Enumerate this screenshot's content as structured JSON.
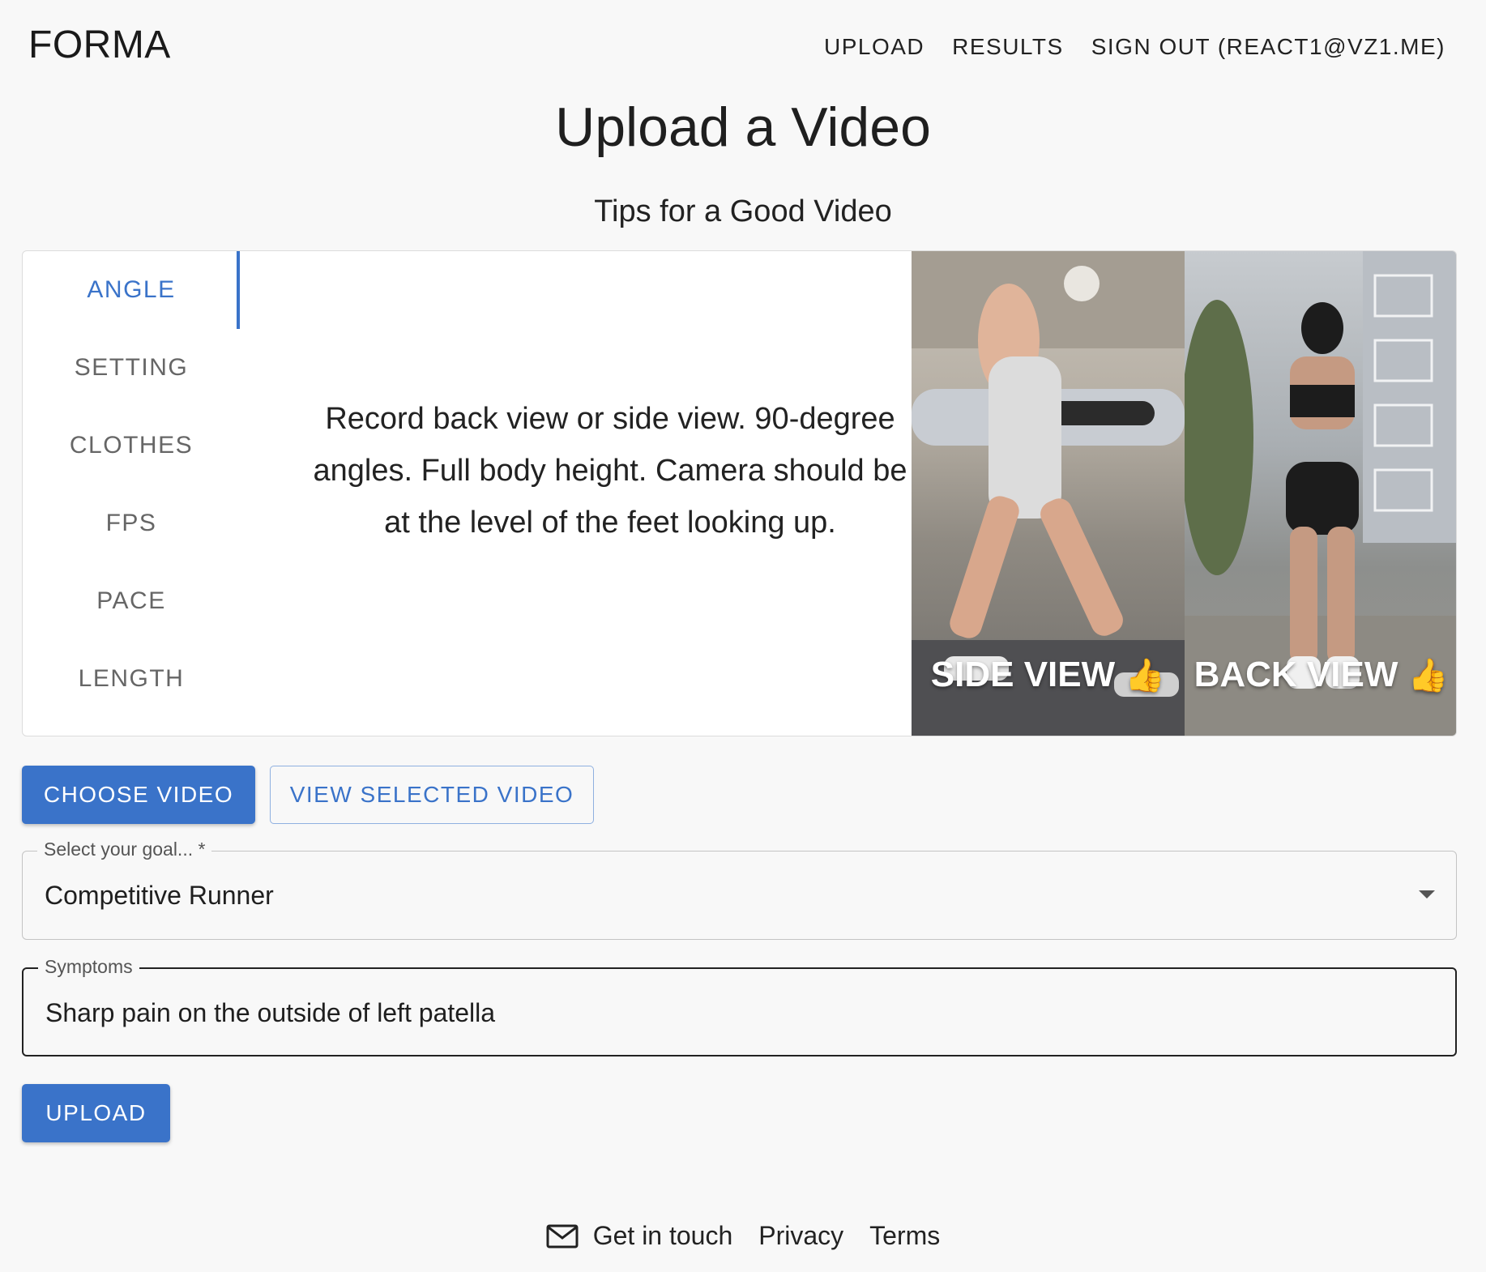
{
  "header": {
    "brand": "FORMA",
    "nav": {
      "upload": "UPLOAD",
      "results": "RESULTS",
      "sign_out": "SIGN OUT (REACT1@VZ1.ME)"
    }
  },
  "page": {
    "title": "Upload a Video",
    "subtitle": "Tips for a Good Video"
  },
  "tips": {
    "tabs": [
      "ANGLE",
      "SETTING",
      "CLOTHES",
      "FPS",
      "PACE",
      "LENGTH"
    ],
    "active_tab": "ANGLE",
    "text": "Record back view or side view. 90-degree angles. Full body height. Camera should be at the level of the feet looking up.",
    "photos": {
      "side_label": "SIDE VIEW",
      "back_label": "BACK VIEW",
      "emoji": "👍"
    }
  },
  "actions": {
    "choose_video": "CHOOSE VIDEO",
    "view_selected": "VIEW SELECTED VIDEO",
    "upload": "UPLOAD"
  },
  "form": {
    "goal": {
      "label": "Select your goal... *",
      "value": "Competitive Runner"
    },
    "symptoms": {
      "label": "Symptoms",
      "value": "Sharp pain on the outside of left patella"
    }
  },
  "footer": {
    "contact": "Get in touch",
    "privacy": "Privacy",
    "terms": "Terms"
  },
  "colors": {
    "accent": "#3a73c9",
    "background": "#f8f8f8"
  }
}
